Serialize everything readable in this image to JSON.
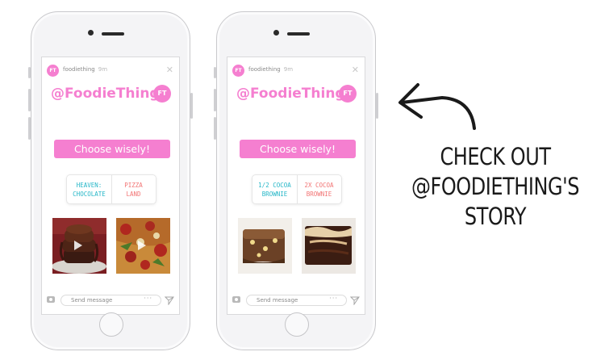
{
  "phones": [
    {
      "account": {
        "avatar": "FT",
        "name": "foodiething",
        "time": "9m"
      },
      "handle": "@FoodieThing",
      "badge": "FT",
      "choose_label": "Choose wisely!",
      "poll": {
        "left": {
          "line1": "HEAVEN:",
          "line2": "CHOCOLATE"
        },
        "right": {
          "line1": "PIZZA",
          "line2": "LAND"
        }
      },
      "send_placeholder": "Send message",
      "more": "···"
    },
    {
      "account": {
        "avatar": "FT",
        "name": "foodiething",
        "time": "9m"
      },
      "handle": "@FoodieThing",
      "badge": "FT",
      "choose_label": "Choose wisely!",
      "poll": {
        "left": {
          "line1": "1/2 COCOA",
          "line2": "BROWNIE"
        },
        "right": {
          "line1": "2X COCOA",
          "line2": "BROWNIE"
        }
      },
      "send_placeholder": "Send message",
      "more": "···"
    }
  ],
  "caption": {
    "line1": "CHECK OUT",
    "line2": "@FOODIETHING'S",
    "line3": "STORY"
  },
  "icons": [
    "camera-icon",
    "send-icon",
    "close-icon",
    "play-icon",
    "arrow-icon"
  ],
  "colors": {
    "brand_pink": "#f57fd0",
    "poll_teal": "#27b7c8",
    "poll_red": "#f27474"
  }
}
